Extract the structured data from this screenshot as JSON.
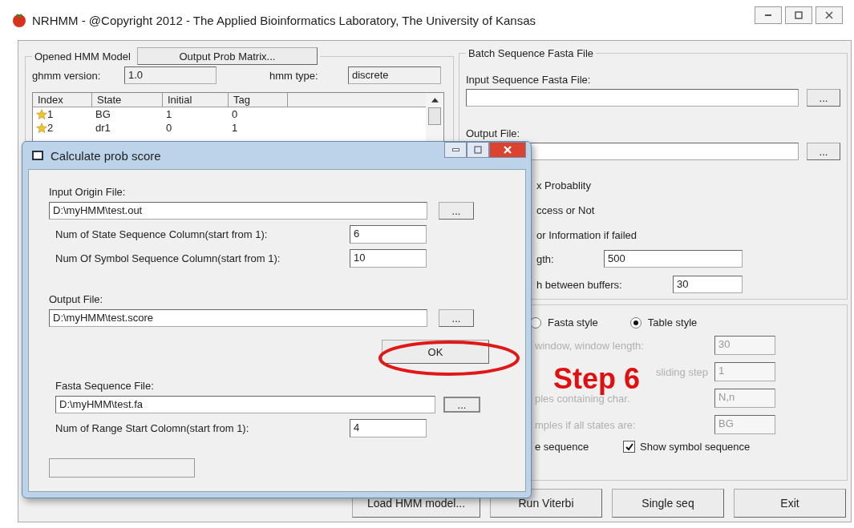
{
  "window": {
    "title": "NRHMM - @Copyright 2012 - The Applied Bioinformatics Laboratory, The University of Kansas"
  },
  "model_group": {
    "title": "Opened HMM Model",
    "matrix_button": "Output Prob Matrix...",
    "version_label": "ghmm version:",
    "version_value": "1.0",
    "type_label": "hmm type:",
    "type_value": "discrete",
    "columns": [
      "Index",
      "State",
      "Initial",
      "Tag"
    ],
    "rows": [
      [
        "1",
        "BG",
        "1",
        "0"
      ],
      [
        "2",
        "dr1",
        "0",
        "1"
      ]
    ]
  },
  "batch_group": {
    "title": "Batch Sequence Fasta File",
    "input_label": "Input Sequence Fasta File:",
    "input_browse": "...",
    "output_label": "Output File:",
    "output_browse": "...",
    "options": [
      "x Probablity",
      "ccess or Not",
      "or Information if failed"
    ],
    "length_label": "gth:",
    "length_value": "500",
    "buffer_label": "h between buffers:",
    "buffer_value": "30"
  },
  "style_group": {
    "radios": [
      {
        "label": "Fasta style",
        "selected": false
      },
      {
        "label": "Table style",
        "selected": true
      }
    ],
    "params": [
      {
        "label": "window, window length:",
        "value": "30",
        "disabled": true
      },
      {
        "label": "sliding step",
        "value": "1",
        "disabled": true
      },
      {
        "label": "ples containing char.",
        "value": "N,n",
        "disabled": true
      },
      {
        "label": "mples if all states are:",
        "value": "BG",
        "disabled": true
      }
    ],
    "state_seq_label": "e sequence",
    "symbol_seq": {
      "label": "Show symbol sequence",
      "checked": true
    }
  },
  "buttons": [
    "Load HMM model...",
    "Run Viterbi",
    "Single seq",
    "Exit"
  ],
  "dialog": {
    "title": "Calculate prob score",
    "input_label": "Input Origin File:",
    "input_value": "D:\\myHMM\\test.out",
    "input_browse": "...",
    "state_col_label": "Num of State Sequence Column(start from 1):",
    "state_col_value": "6",
    "symbol_col_label": "Num Of Symbol Sequence Column(start from 1):",
    "symbol_col_value": "10",
    "output_label": "Output File:",
    "output_value": "D:\\myHMM\\test.score",
    "output_browse": "...",
    "ok": "OK",
    "fasta_label": "Fasta Sequence File:",
    "fasta_value": "D:\\myHMM\\test.fa",
    "fasta_browse": "...",
    "range_label": "Num of Range Start Colomn(start from 1):",
    "range_value": "4"
  },
  "annotation": {
    "label": "Step 6"
  }
}
